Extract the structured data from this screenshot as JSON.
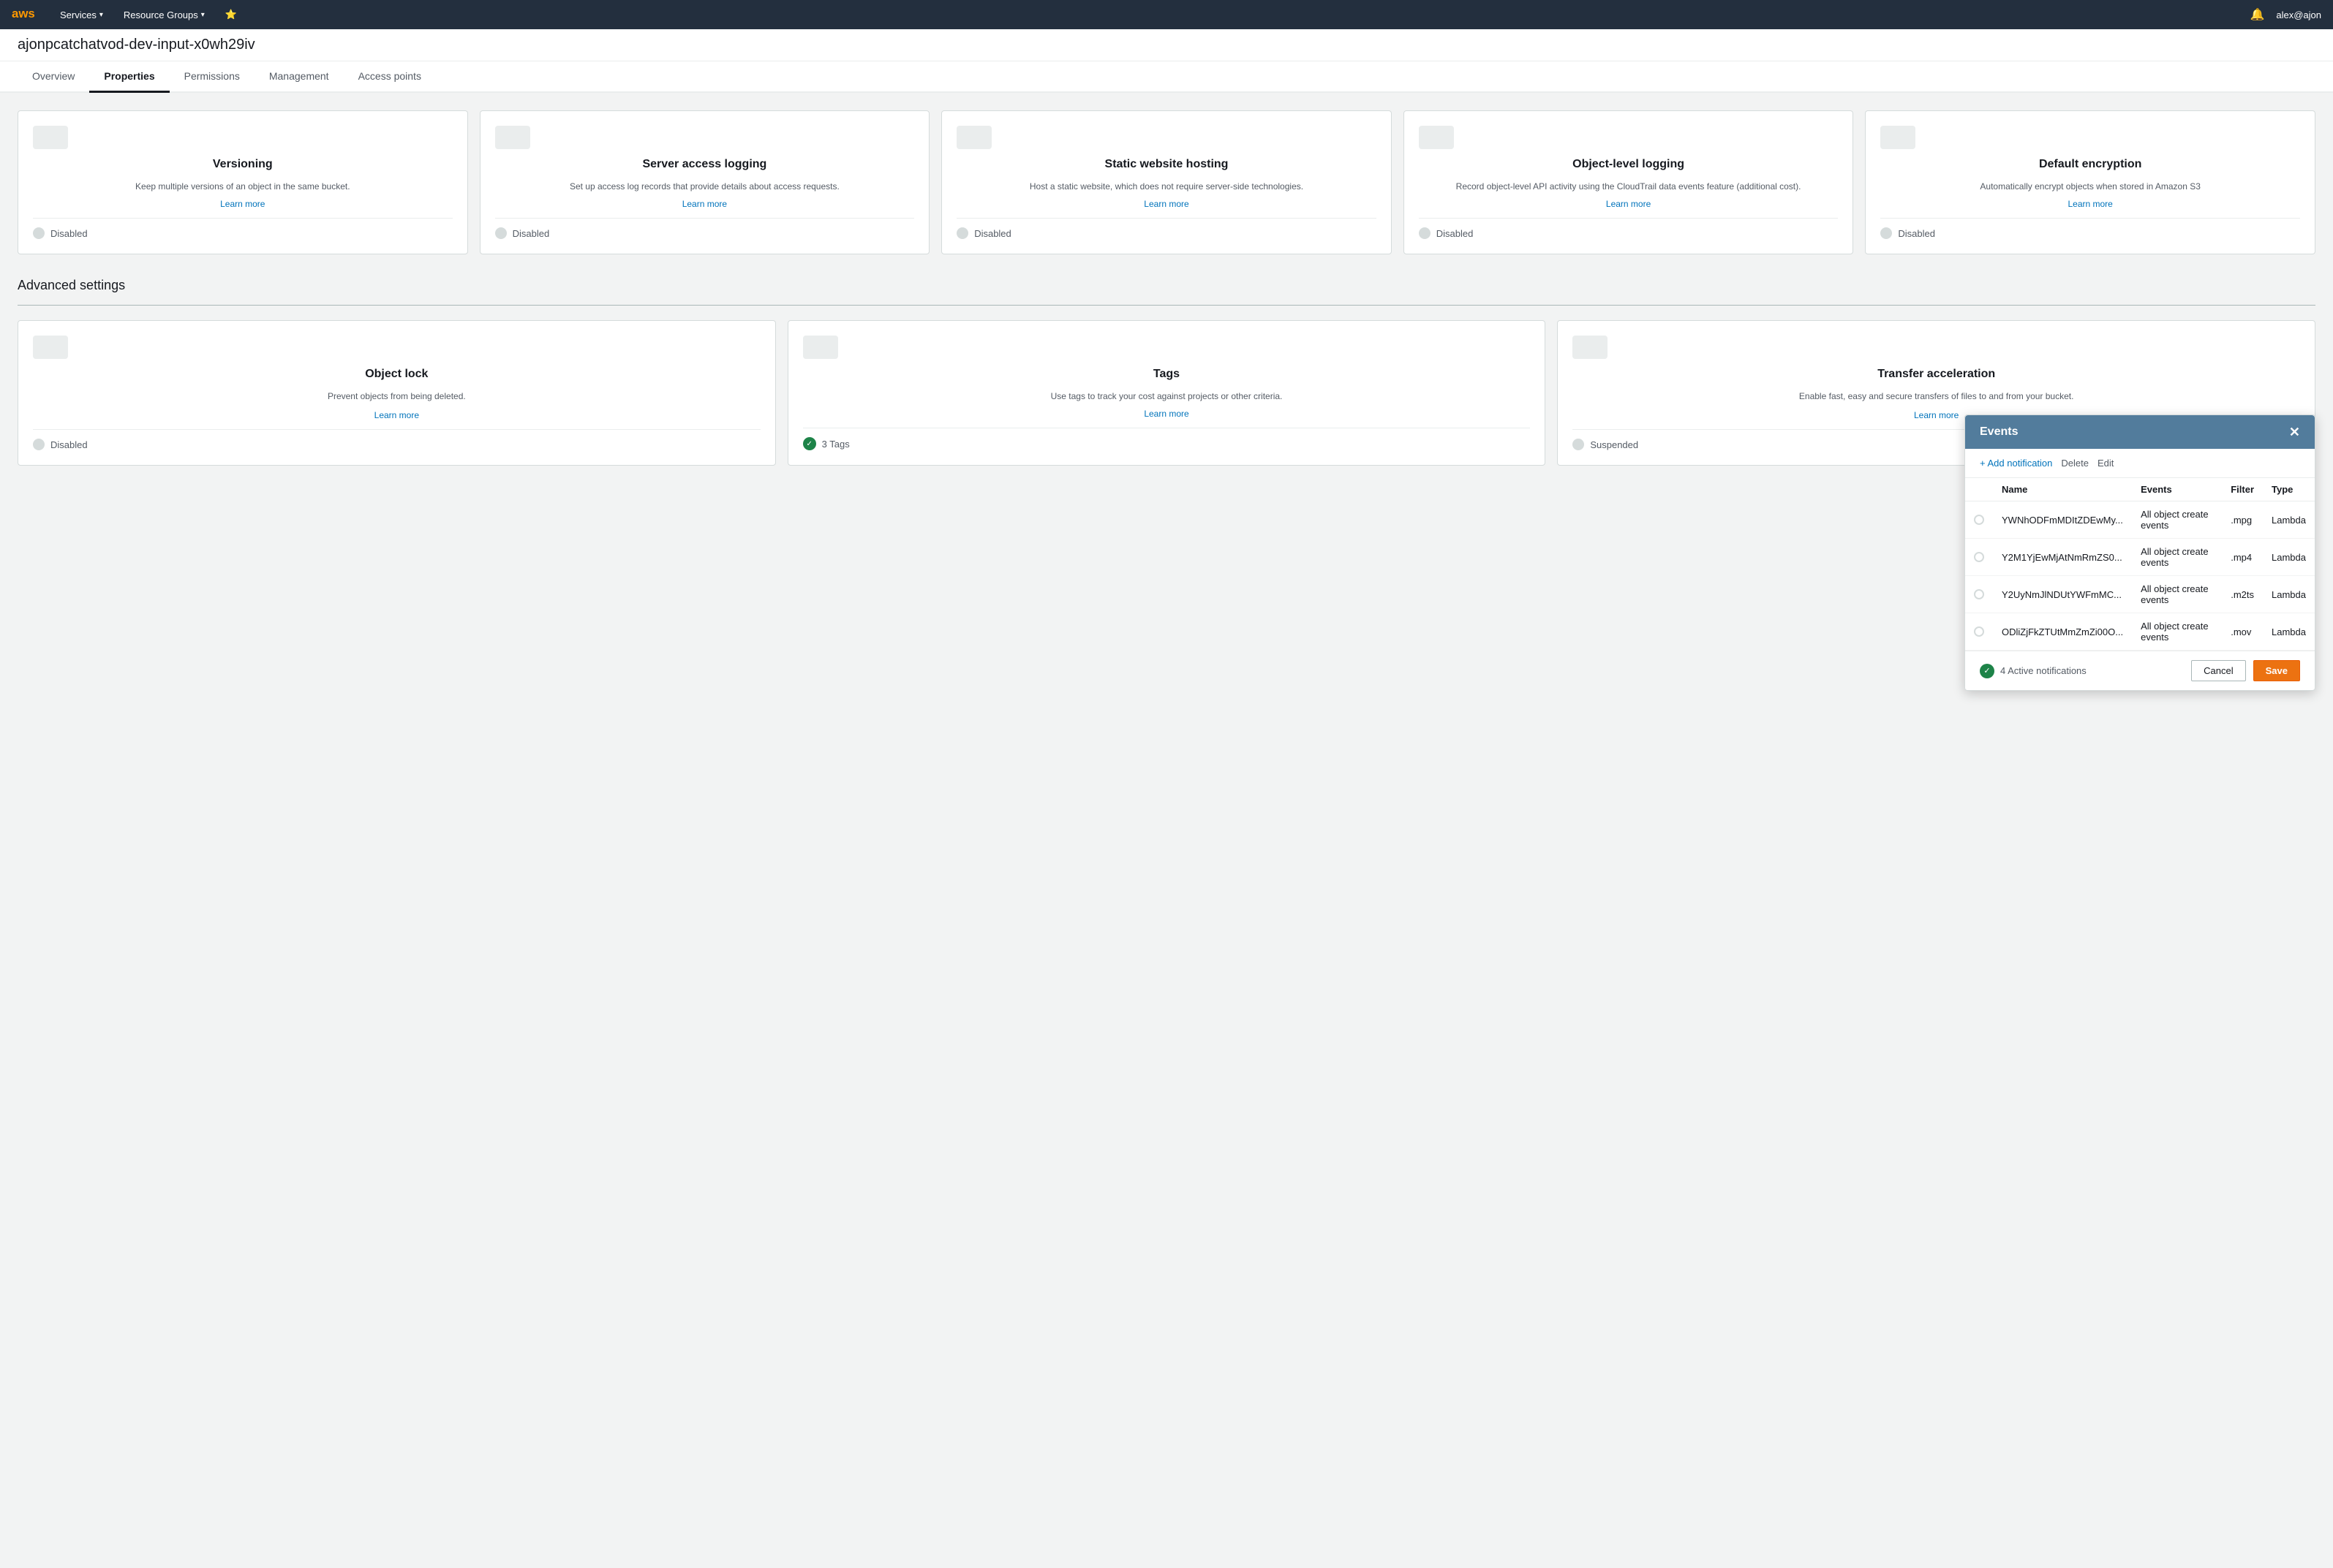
{
  "nav": {
    "services_label": "Services",
    "resource_groups_label": "Resource Groups",
    "bell_icon": "🔔",
    "user": "alex@ajon",
    "aws_logo": "aws"
  },
  "bucket": {
    "title": "ajonpcatchatvod-dev-input-x0wh29iv"
  },
  "tabs": [
    {
      "id": "overview",
      "label": "Overview",
      "active": false
    },
    {
      "id": "properties",
      "label": "Properties",
      "active": true
    },
    {
      "id": "permissions",
      "label": "Permissions",
      "active": false
    },
    {
      "id": "management",
      "label": "Management",
      "active": false
    },
    {
      "id": "access_points",
      "label": "Access points",
      "active": false
    }
  ],
  "property_cards": [
    {
      "title": "Versioning",
      "description": "Keep multiple versions of an object in the same bucket.",
      "learn_more": "Learn more",
      "status": "Disabled"
    },
    {
      "title": "Server access logging",
      "description": "Set up access log records that provide details about access requests.",
      "learn_more": "Learn more",
      "status": "Disabled"
    },
    {
      "title": "Static website hosting",
      "description": "Host a static website, which does not require server-side technologies.",
      "learn_more": "Learn more",
      "status": "Disabled"
    },
    {
      "title": "Object-level logging",
      "description": "Record object-level API activity using the CloudTrail data events feature (additional cost).",
      "learn_more": "Learn more",
      "status": "Disabled"
    },
    {
      "title": "Default encryption",
      "description": "Automatically encrypt objects when stored in Amazon S3",
      "learn_more": "Learn more",
      "status": "Disabled"
    }
  ],
  "advanced_settings": {
    "title": "Advanced settings"
  },
  "advanced_cards": [
    {
      "title": "Object lock",
      "description": "Prevent objects from being deleted.",
      "learn_more": "Learn more",
      "status": "Disabled",
      "status_type": "disabled"
    },
    {
      "title": "Tags",
      "description": "Use tags to track your cost against projects or other criteria.",
      "learn_more": "Learn more",
      "status": "3 Tags",
      "status_type": "active"
    },
    {
      "title": "Transfer acceleration",
      "description": "Enable fast, easy and secure transfers of files to and from your bucket.",
      "learn_more": "Learn more",
      "status": "Suspended",
      "status_type": "disabled"
    }
  ],
  "events_modal": {
    "title": "Events",
    "add_notification_label": "+ Add notification",
    "delete_label": "Delete",
    "edit_label": "Edit",
    "columns": [
      "Name",
      "Events",
      "Filter",
      "Type"
    ],
    "rows": [
      {
        "name": "YWNhODFmMDItZDEwMy...",
        "events": "All object create events",
        "filter": ".mpg",
        "type": "Lambda"
      },
      {
        "name": "Y2M1YjEwMjAtNmRmZS0...",
        "events": "All object create events",
        "filter": ".mp4",
        "type": "Lambda"
      },
      {
        "name": "Y2UyNmJlNDUtYWFmMC...",
        "events": "All object create events",
        "filter": ".m2ts",
        "type": "Lambda"
      },
      {
        "name": "ODliZjFkZTUtMmZmZi00O...",
        "events": "All object create events",
        "filter": ".mov",
        "type": "Lambda"
      }
    ],
    "footer_status": "4 Active notifications",
    "cancel_label": "Cancel",
    "save_label": "Save"
  }
}
